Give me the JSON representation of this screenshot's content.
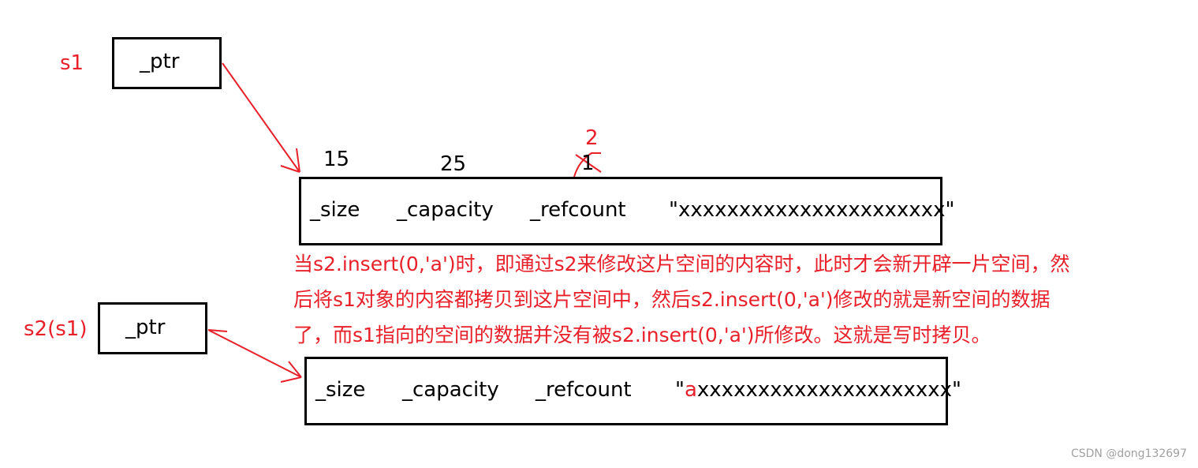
{
  "s1": {
    "label": "s1",
    "ptr": "_ptr"
  },
  "s2": {
    "label": "s2(s1)",
    "ptr": "_ptr"
  },
  "block1": {
    "size_value": "15",
    "capacity_value": "25",
    "refcount_old": "1",
    "refcount_new": "2",
    "fields": [
      "_size",
      "_capacity",
      "_refcount"
    ],
    "data": "\"xxxxxxxxxxxxxxxxxxxxxx\""
  },
  "block2": {
    "fields": [
      "_size",
      "_capacity",
      "_refcount"
    ],
    "data_prefix": "\"",
    "data_highlight": "a",
    "data_rest": "xxxxxxxxxxxxxxxxxxxxx\""
  },
  "note": {
    "lines": [
      "当s2.insert(0,'a')时，即通过s2来修改这片空间的内容时，此时才会新开辟一片空间，然",
      "后将s1对象的内容都拷贝到这片空间中，然后s2.insert(0,'a')修改的就是新空间的数据",
      "了，而s1指向的空间的数据并没有被s2.insert(0,'a')所修改。这就是写时拷贝。"
    ]
  },
  "watermark": "CSDN @dong132697",
  "colors": {
    "annotation": "#e8202a",
    "outline": "#000000"
  }
}
